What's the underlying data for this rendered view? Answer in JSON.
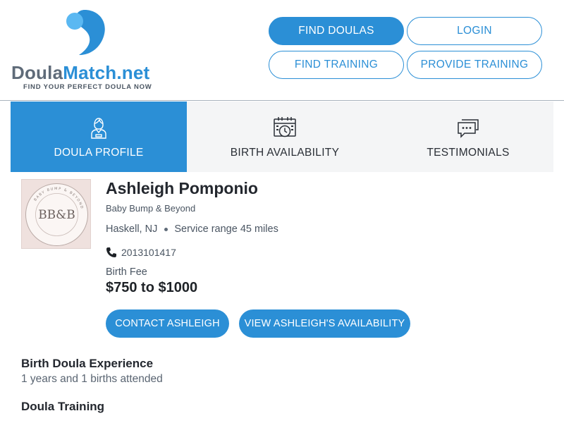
{
  "brand": {
    "name_part1": "Doula",
    "name_part2": "Match.net",
    "tagline": "FIND YOUR PERFECT DOULA NOW",
    "colors": {
      "primary": "#2b8fd6",
      "logo_gray": "#5f6b79",
      "logo_light_blue": "#5ab8f2"
    }
  },
  "nav": {
    "find_doulas": "FIND DOULAS",
    "login": "LOGIN",
    "find_training": "FIND TRAINING",
    "provide_training": "PROVIDE TRAINING"
  },
  "tabs": [
    {
      "label": "DOULA PROFILE",
      "icon": "person-icon",
      "active": true
    },
    {
      "label": "BIRTH AVAILABILITY",
      "icon": "calendar-clock-icon",
      "active": false
    },
    {
      "label": "TESTIMONIALS",
      "icon": "chat-bubbles-icon",
      "active": false
    }
  ],
  "profile": {
    "logo_text": "BB&B",
    "logo_ring_text": "BABY BUMP & BEYOND",
    "name": "Ashleigh Pomponio",
    "business": "Baby Bump & Beyond",
    "city": "Haskell, NJ",
    "service_range": "Service range 45 miles",
    "phone": "2013101417",
    "fee_label": "Birth Fee",
    "fee_value": "$750 to $1000",
    "contact_button": "CONTACT ASHLEIGH",
    "availability_button": "VIEW ASHLEIGH'S AVAILABILITY"
  },
  "sections": {
    "experience_heading": "Birth Doula Experience",
    "experience_text": "1 years and 1 births attended",
    "training_heading": "Doula Training"
  }
}
